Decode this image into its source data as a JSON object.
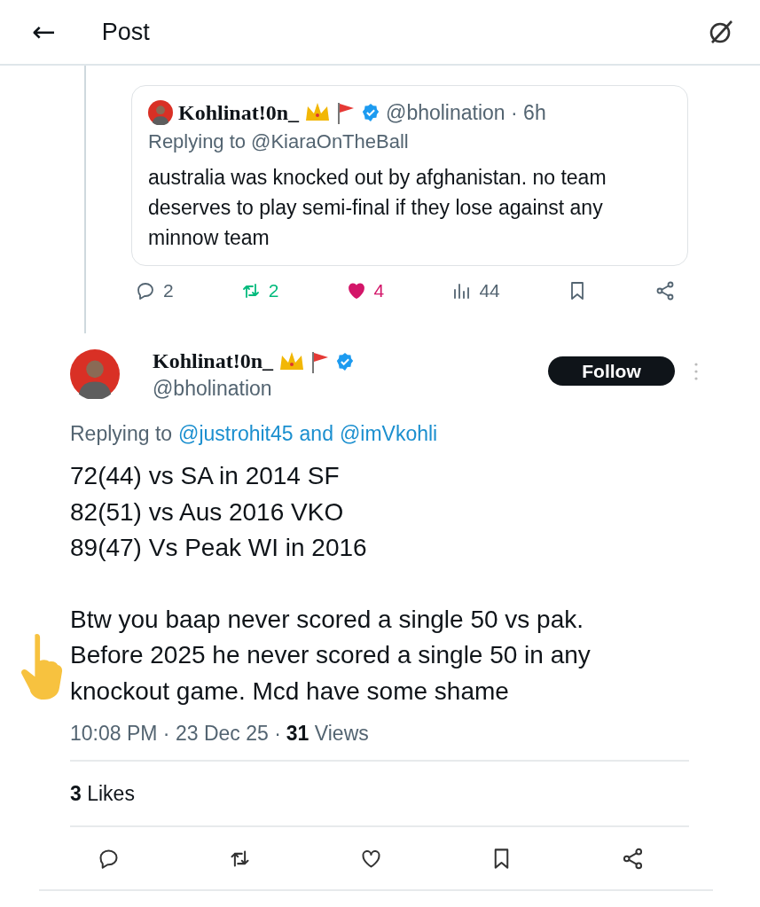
{
  "header": {
    "back": "←",
    "title": "Post"
  },
  "quoted_reply": {
    "display_name": "Kohlinat!0n_",
    "verified": true,
    "handle": "@bholination",
    "separator": "·",
    "time": "6h",
    "replying_to_label": "Replying to",
    "replying_to": [
      "@KiaraOnTheBall"
    ],
    "text": "australia was knocked out by afghanistan.  no team deserves to play semi-final if they lose against any minnow team",
    "actions": [
      {
        "kind": "reply",
        "count": "2"
      },
      {
        "kind": "repost",
        "count": "2",
        "active": true
      },
      {
        "kind": "like",
        "count": "4",
        "active": true
      },
      {
        "kind": "views",
        "count": "44"
      },
      {
        "kind": "bookmark"
      },
      {
        "kind": "share"
      }
    ]
  },
  "post": {
    "display_name": "Kohlinat!0n_",
    "verified": true,
    "handle": "@bholination",
    "follow_button": "Follow",
    "replying_to_label": "Replying to",
    "replying_to": [
      "@justrohit45",
      "@imVkohli"
    ],
    "replying_joiner": "and",
    "paragraphs": [
      [
        "72(44) vs SA in 2014 SF",
        "82(51) vs Aus 2016 VKO",
        "89(47) Vs Peak WI in 2016"
      ],
      [
        "Btw you baap never scored a single 50 vs pak.",
        "Before 2025 he never scored a single 50 in any",
        "knockout game. Mcd have some shame"
      ]
    ],
    "time": "10:08 PM",
    "separator": "·",
    "date": "23 Dec 25",
    "views_count": "31",
    "views_label": "Views",
    "likes_count": "3",
    "likes_label": "Likes",
    "actions": [
      {
        "kind": "reply",
        "active": false
      },
      {
        "kind": "repost",
        "active": false
      },
      {
        "kind": "like",
        "active": false
      },
      {
        "kind": "bookmark",
        "active": false
      },
      {
        "kind": "share",
        "active": false
      }
    ]
  }
}
